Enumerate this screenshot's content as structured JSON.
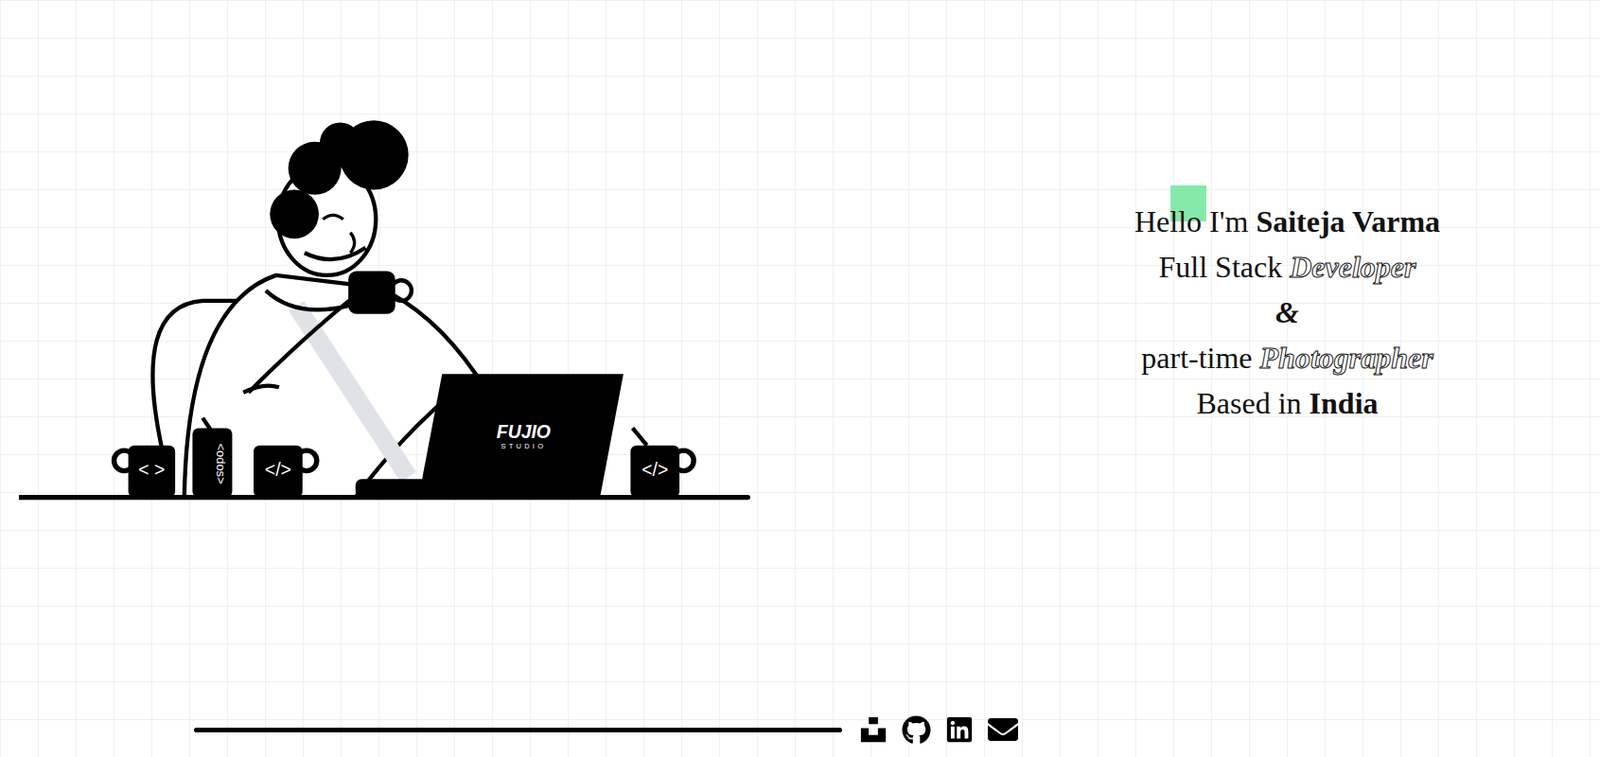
{
  "intro": {
    "lines": [
      [
        {
          "text": "Hello I'm ",
          "kind": "plain"
        },
        {
          "text": "Saiteja Varma",
          "kind": "bold"
        }
      ],
      [
        {
          "text": "Full Stack ",
          "kind": "plain"
        },
        {
          "text": "Developer",
          "kind": "outline"
        }
      ],
      [
        {
          "text": "&",
          "kind": "italic"
        }
      ],
      [
        {
          "text": "part-time ",
          "kind": "plain"
        },
        {
          "text": "Photographer",
          "kind": "outline"
        }
      ],
      [
        {
          "text": "Based in ",
          "kind": "plain"
        },
        {
          "text": "India",
          "kind": "bold"
        }
      ]
    ]
  },
  "illustration": {
    "mugs": [
      "< >",
      "</>",
      "</>"
    ],
    "can": "<odos>",
    "laptop_brand": "FUJIO",
    "laptop_sub": "STUDIO"
  }
}
